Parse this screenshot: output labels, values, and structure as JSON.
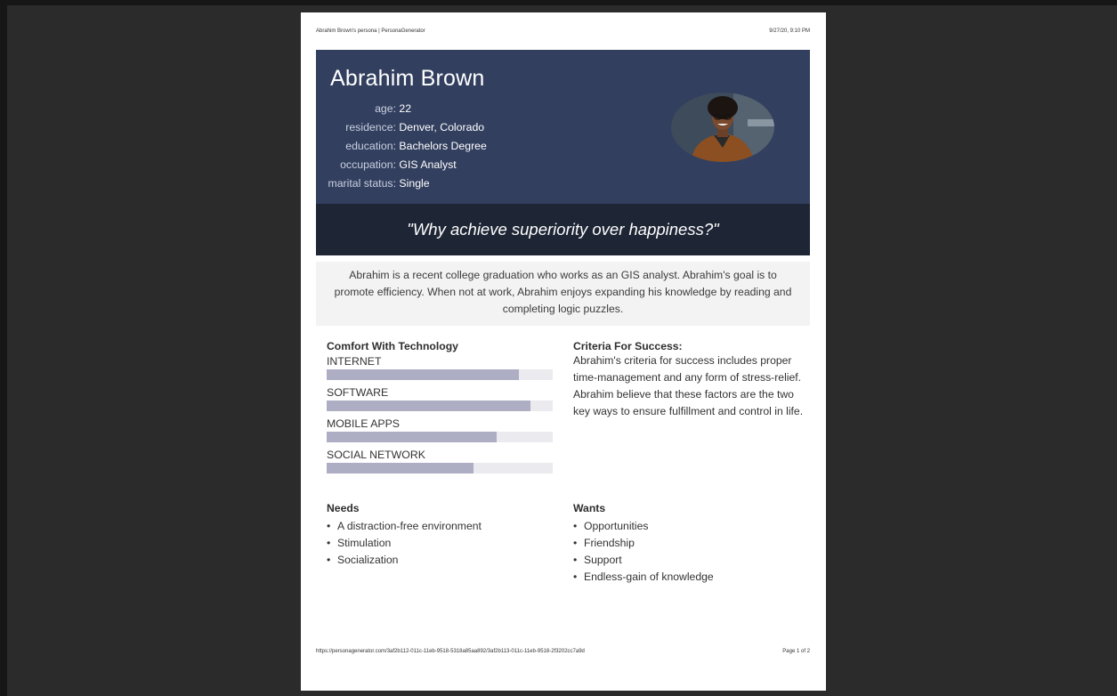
{
  "print_header": {
    "title": "Abrahim Brown's persona | PersonaGenerator",
    "datetime": "9/27/20, 9:10 PM"
  },
  "persona": {
    "name": "Abrahim Brown",
    "facts": [
      {
        "label": "age:",
        "value": "22"
      },
      {
        "label": "residence:",
        "value": "Denver, Colorado"
      },
      {
        "label": "education:",
        "value": "Bachelors Degree"
      },
      {
        "label": "occupation:",
        "value": "GIS Analyst"
      },
      {
        "label": "marital status:",
        "value": "Single"
      }
    ],
    "quote": "\"Why achieve superiority over happiness?\"",
    "bio": "Abrahim is a recent college graduation who works as an GIS analyst. Abrahim's goal is to promote efficiency. When not at work, Abrahim enjoys expanding his knowledge by reading and completing logic puzzles."
  },
  "technology": {
    "title": "Comfort With Technology",
    "items": [
      {
        "label": "INTERNET",
        "level": 0.85
      },
      {
        "label": "SOFTWARE",
        "level": 0.9
      },
      {
        "label": "MOBILE APPS",
        "level": 0.75
      },
      {
        "label": "SOCIAL NETWORK",
        "level": 0.65
      }
    ]
  },
  "criteria": {
    "title": "Criteria For Success:",
    "text": "Abrahim's criteria for success includes proper time-management and any form of stress-relief. Abrahim believe that these factors are the two key ways to ensure fulfillment and control in life."
  },
  "needs": {
    "title": "Needs",
    "items": [
      "A distraction-free environment",
      "Stimulation",
      "Socialization"
    ]
  },
  "wants": {
    "title": "Wants",
    "items": [
      "Opportunities",
      "Friendship",
      "Support",
      "Endless-gain of knowledge"
    ]
  },
  "print_footer": {
    "url": "https://personagenerator.com/3af2b112-011c-11eb-9518-5318a85aa892/3af2b113-011c-11eb-9518-2f3202cc7a9d",
    "page": "Page 1 of 2"
  },
  "colors": {
    "hero_bg": "#323f5f",
    "quote_bg": "#1e2535",
    "bar_fill": "#adadc4",
    "bar_track": "#ebebef"
  },
  "icons": {
    "bullet": "•"
  }
}
